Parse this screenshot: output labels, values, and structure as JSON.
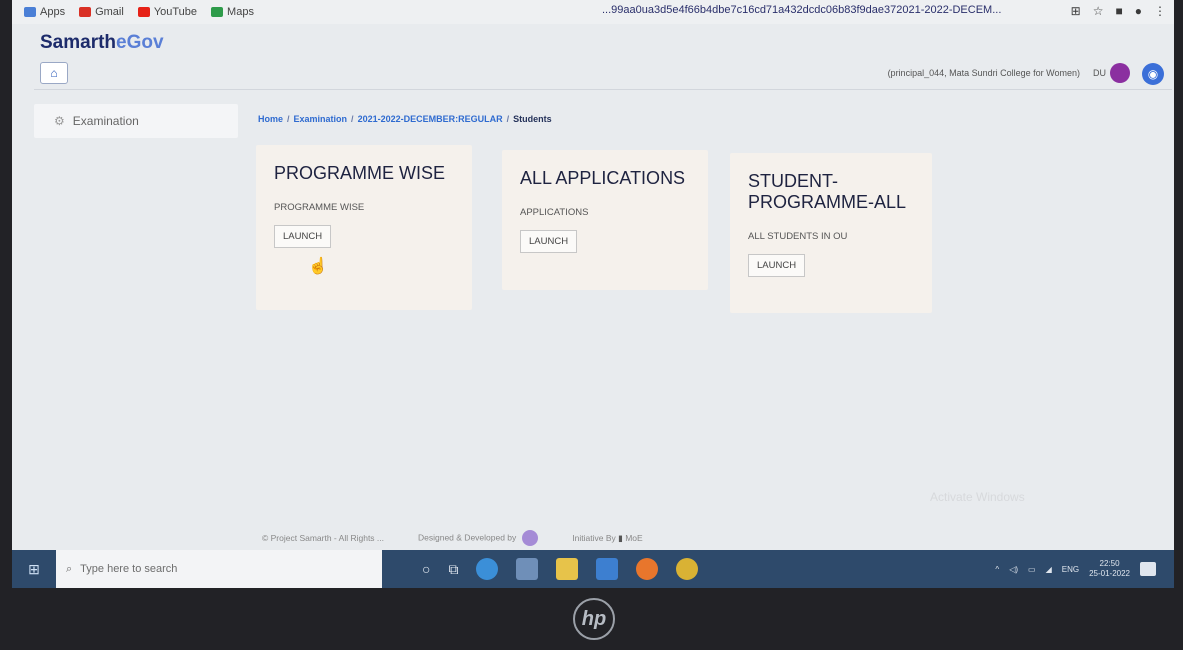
{
  "bookmarks": [
    {
      "label": "Apps",
      "color": "#4a7fd6"
    },
    {
      "label": "Gmail",
      "color": "#d93025"
    },
    {
      "label": "YouTube",
      "color": "#e62117"
    },
    {
      "label": "Maps",
      "color": "#2e9b4a"
    }
  ],
  "browser": {
    "url_fragment": "...99aa0ua3d5e4f66b4dbe7c16cd71a432dcdc06b83f9dae372021-2022-DECEM..."
  },
  "app": {
    "brand_main": "Samarth",
    "brand_accent": "eGov"
  },
  "topbar": {
    "home_icon": "home-icon",
    "user_text": "(principal_044, Mata Sundri College for Women)",
    "role": "DU"
  },
  "sidebar": {
    "items": [
      {
        "label": "Examination",
        "icon": "gear-icon"
      }
    ]
  },
  "breadcrumb": {
    "items": [
      "Home",
      "Examination",
      "2021-2022-DECEMBER:REGULAR",
      "Students"
    ]
  },
  "cards": [
    {
      "title": "PROGRAMME WISE",
      "subtitle": "PROGRAMME WISE",
      "button": "LAUNCH"
    },
    {
      "title": "ALL APPLICATIONS",
      "subtitle": "APPLICATIONS",
      "button": "LAUNCH"
    },
    {
      "title": "STUDENT-PROGRAMME-ALL",
      "subtitle": "ALL STUDENTS IN OU",
      "button": "LAUNCH"
    }
  ],
  "footer": {
    "copyright": "© Project Samarth - All Rights ...",
    "designed": "Designed & Developed by",
    "initiative": "Initiative By",
    "moe": "MoE"
  },
  "watermark": "Activate Windows",
  "taskbar": {
    "search_placeholder": "Type here to search",
    "lang": "ENG",
    "time": "22:50",
    "date": "25-01-2022"
  },
  "device": {
    "logo": "hp"
  },
  "colors": {
    "brand": "#1d2b6b",
    "accent": "#5a7fd6",
    "link": "#2f6bd0",
    "taskbar": "#2e4a6b"
  }
}
